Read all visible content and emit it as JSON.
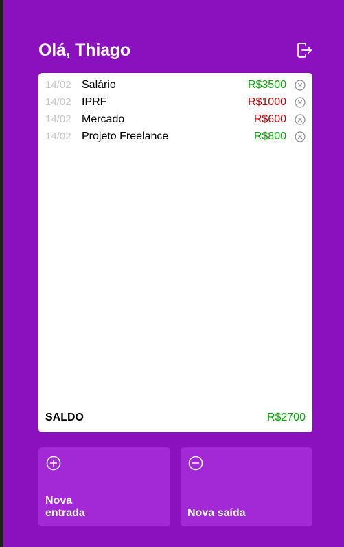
{
  "header": {
    "greeting": "Olá, Thiago"
  },
  "transactions": [
    {
      "date": "14/02",
      "description": "Salário",
      "amount": "R$3500",
      "type": "in"
    },
    {
      "date": "14/02",
      "description": "IPRF",
      "amount": "R$1000",
      "type": "out"
    },
    {
      "date": "14/02",
      "description": "Mercado",
      "amount": "R$600",
      "type": "out"
    },
    {
      "date": "14/02",
      "description": "Projeto Freelance",
      "amount": "R$800",
      "type": "in"
    }
  ],
  "balance": {
    "label": "SALDO",
    "value": "R$2700"
  },
  "actions": {
    "new_income": "Nova entrada",
    "new_expense": "Nova saída"
  },
  "colors": {
    "background": "#8c11be",
    "button": "#a328d6",
    "income": "#03ac00",
    "expense": "#c70000"
  },
  "icons": {
    "logout": "logout-icon",
    "delete": "close-circle-icon",
    "add": "plus-circle-icon",
    "remove": "minus-circle-icon"
  }
}
